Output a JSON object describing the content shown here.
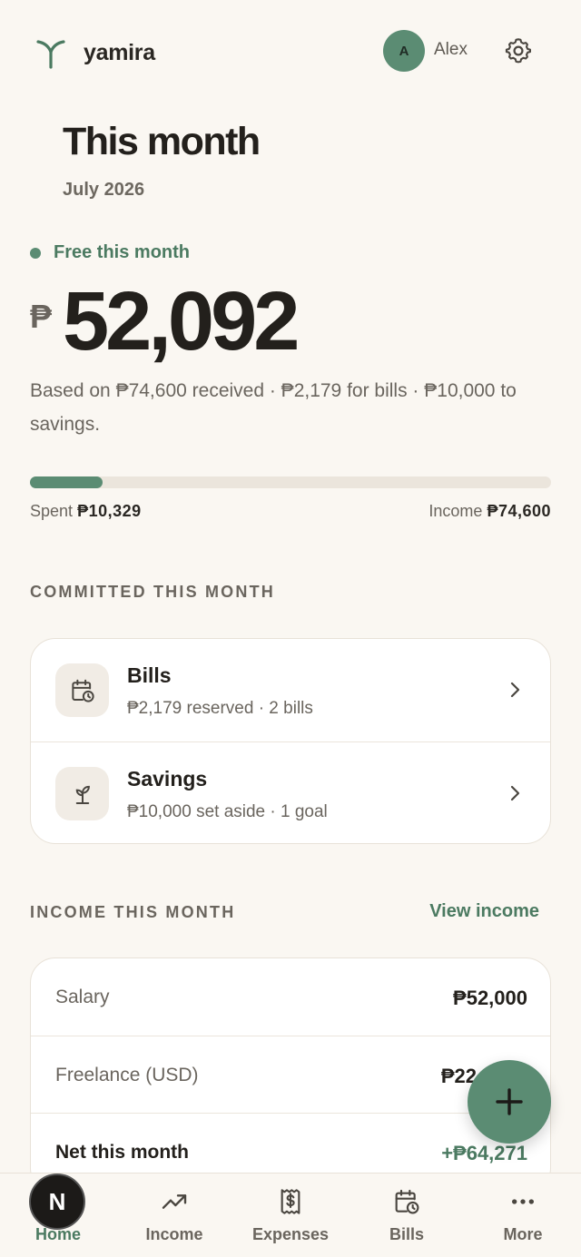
{
  "header": {
    "brand": "yamira",
    "avatar_initial": "A",
    "user_name": "Alex"
  },
  "title": {
    "heading": "This month",
    "period": "July 2026"
  },
  "summary": {
    "free_label": "Free this month",
    "currency": "₱",
    "amount": "52,092",
    "based_on": "Based on ₱74,600 received · ₱2,179 for bills · ₱10,000 to savings.",
    "progress_fraction": 0.139,
    "spent_label": "Spent",
    "spent_value": "₱10,329",
    "income_label": "Income",
    "income_value": "₱74,600"
  },
  "committed": {
    "label": "COMMITTED THIS MONTH",
    "items": [
      {
        "title": "Bills",
        "subtitle": "₱2,179 reserved · 2 bills",
        "icon": "calendar-clock-icon"
      },
      {
        "title": "Savings",
        "subtitle": "₱10,000 set aside · 1 goal",
        "icon": "sprout-icon"
      }
    ]
  },
  "income": {
    "label": "INCOME THIS MONTH",
    "link": "View income",
    "rows": [
      {
        "name": "Salary",
        "value": "₱52,000"
      },
      {
        "name": "Freelance (USD)",
        "value": "₱22"
      },
      {
        "name": "Net this month",
        "value": "+₱64,271"
      }
    ]
  },
  "nav": {
    "tabs": [
      {
        "label": "Home",
        "icon": "home-icon",
        "active": true
      },
      {
        "label": "Income",
        "icon": "trending-up-icon"
      },
      {
        "label": "Expenses",
        "icon": "receipt-icon"
      },
      {
        "label": "Bills",
        "icon": "calendar-clock-icon"
      },
      {
        "label": "More",
        "icon": "more-dots-icon"
      }
    ],
    "dev_badge": "N"
  },
  "colors": {
    "accent": "#5b8c73",
    "accent_text": "#4b7a61",
    "background": "#faf7f2"
  }
}
